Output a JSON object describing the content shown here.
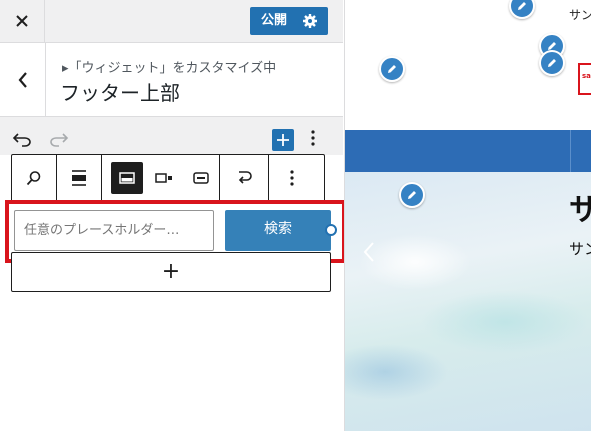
{
  "header": {
    "close_label": "Close",
    "publish_label": "公開"
  },
  "section": {
    "breadcrumb": "▸「ウィジェット」をカスタマイズ中",
    "title": "フッター上部"
  },
  "block": {
    "toolbar_buttons": [
      "search-icon",
      "align-icon",
      "button-inside-icon",
      "button-outside-icon",
      "button-only-icon",
      "link-icon",
      "more-options-icon"
    ],
    "search_placeholder": "任意のプレースホルダー…",
    "search_button_label": "検索",
    "appender_label": "+"
  },
  "preview": {
    "tagline": "サン",
    "hero_title": "サ",
    "hero_subtitle": "サン",
    "logo_text": "sa"
  },
  "colors": {
    "accent": "#2271b1",
    "highlight": "#d9141c",
    "nav": "#2d6cb5"
  }
}
